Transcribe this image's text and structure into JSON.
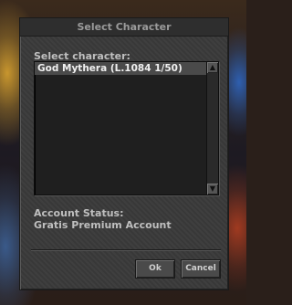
{
  "dialog": {
    "title": "Select Character",
    "select_label": "Select character:",
    "characters": [
      {
        "label": "God Mythera (L.1084 1/50)",
        "selected": true
      }
    ],
    "account_status_label": "Account Status:",
    "account_status_value": "Gratis Premium Account",
    "ok_label": "Ok",
    "cancel_label": "Cancel"
  },
  "icons": {
    "scroll_up": "arrow-up-icon",
    "scroll_down": "arrow-down-icon"
  },
  "colors": {
    "panel": "#3a3a3a",
    "selected_row": "#4a4a4a",
    "text": "#bfbfbf"
  }
}
